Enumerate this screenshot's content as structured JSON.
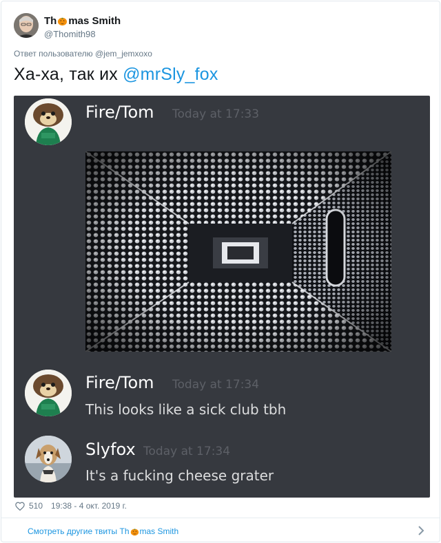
{
  "author": {
    "name_before": "Th",
    "name_after": "mas Smith",
    "handle": "@Thomith98"
  },
  "reply_to": "Ответ пользователю @jem_jemxoxo",
  "tweet": {
    "text": "Ха-ха, так их ",
    "mention": "@mrSly_fox"
  },
  "discord": {
    "messages": [
      {
        "author": "Fire/Tom",
        "time": "Today at 17:33",
        "text": ""
      },
      {
        "author": "Fire/Tom",
        "time": "Today at 17:34",
        "text": "This looks like a sick club tbh"
      },
      {
        "author": "Slyfox",
        "time": "Today at 17:34",
        "text": "It's a fucking cheese grater"
      }
    ],
    "colors": {
      "background": "#36393f",
      "username": "#ffffff",
      "timestamp": "#5d6067",
      "message": "#dcddde"
    }
  },
  "stats": {
    "likes": "510",
    "datetime": "19:38 - 4 окт. 2019 г."
  },
  "footer": {
    "more_before": "Смотреть другие твиты Th",
    "more_after": "mas Smith"
  },
  "icons": [
    "pumpkin-emoji",
    "heart-icon",
    "chevron-right-icon"
  ],
  "colors": {
    "link": "#1b95e0",
    "muted": "#657786",
    "text": "#14171a"
  }
}
